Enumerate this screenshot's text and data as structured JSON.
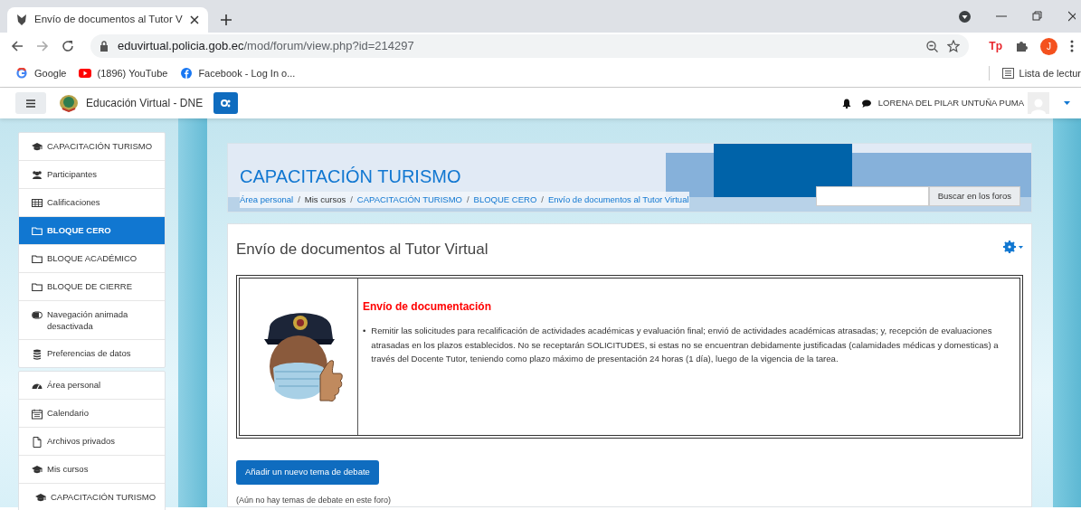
{
  "browser": {
    "tab": {
      "title": "Envío de documentos al Tutor V"
    },
    "url": {
      "domain": "eduvirtual.policia.gob.ec",
      "path": "/mod/forum/view.php?id=214297"
    },
    "extension_label": "Tp",
    "profile_initial": "J",
    "bookmarks": [
      {
        "kind": "google",
        "label": "Google"
      },
      {
        "kind": "youtube",
        "label": "(1896) YouTube"
      },
      {
        "kind": "facebook",
        "label": "Facebook - Log In o..."
      }
    ],
    "reading_list": "Lista de lectur"
  },
  "navbar": {
    "site_name": "Educación Virtual - DNE",
    "user_name": "LORENA DEL PILAR UNTUÑA PUMA"
  },
  "sidebar": {
    "course_nav": [
      {
        "kind": "course",
        "label": "CAPACITACIÓN TURISMO",
        "selected": false
      },
      {
        "kind": "participants",
        "label": "Participantes",
        "selected": false
      },
      {
        "kind": "grades",
        "label": "Calificaciones",
        "selected": false
      },
      {
        "kind": "section",
        "label": "BLOQUE CERO",
        "selected": true
      },
      {
        "kind": "section",
        "label": "BLOQUE ACADÉMICO",
        "selected": false
      },
      {
        "kind": "section",
        "label": "BLOQUE DE CIERRE",
        "selected": false
      },
      {
        "kind": "toggle",
        "label": "Navegación animada desactivada",
        "selected": false
      },
      {
        "kind": "data",
        "label": "Preferencias de datos",
        "selected": false
      }
    ],
    "site_nav": [
      {
        "kind": "dashboard",
        "label": "Área personal",
        "selected": false
      },
      {
        "kind": "calendar",
        "label": "Calendario",
        "selected": false
      },
      {
        "kind": "files",
        "label": "Archivos privados",
        "selected": false
      },
      {
        "kind": "course",
        "label": "Mis cursos",
        "selected": false,
        "children": [
          {
            "kind": "course",
            "label": "CAPACITACIÓN TURISMO",
            "selected": false
          }
        ]
      }
    ]
  },
  "header": {
    "course_title": "CAPACITACIÓN TURISMO",
    "breadcrumb": [
      {
        "label": "Área personal",
        "link": true
      },
      {
        "label": "Mis cursos",
        "link": false
      },
      {
        "label": "CAPACITACIÓN TURISMO",
        "link": true
      },
      {
        "label": "BLOQUE CERO",
        "link": true
      },
      {
        "label": "Envío de documentos al Tutor Virtual",
        "link": true
      }
    ],
    "separator": "/",
    "search_button": "Buscar en los foros"
  },
  "forum": {
    "title": "Envío de documentos al Tutor Virtual",
    "intro_heading": "Envío de documentación",
    "intro_items": [
      {
        "bullet": "•",
        "text": "Remitir las solicitudes para recalificación de actividades académicas y evaluación final; envió de actividades académicas atrasadas; y, recepción de evaluaciones atrasadas en los plazos establecidos. No se receptarán SOLICITUDES, si estas no se encuentran debidamente justificadas (calamidades médicas y domesticas) a través del Docente Tutor, teniendo como plazo máximo de presentación 24 horas (1 día), luego de la vigencia de la tarea."
      }
    ],
    "add_button": "Añadir un nuevo tema de debate",
    "empty_note": "(Aún no hay temas de debate en este foro)"
  }
}
